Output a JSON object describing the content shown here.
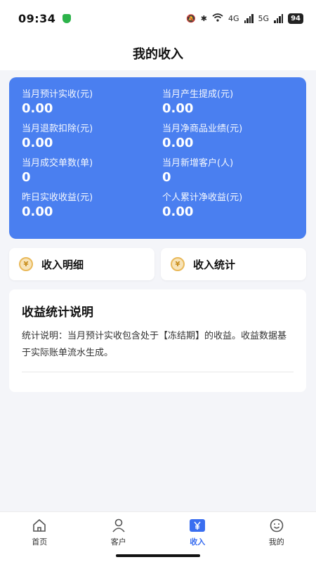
{
  "status_bar": {
    "time": "09:34",
    "network_4g": "4G",
    "network_5g": "5G",
    "battery": "94"
  },
  "header": {
    "title": "我的收入"
  },
  "stats": [
    {
      "label": "当月预计实收(元)",
      "value": "0.00"
    },
    {
      "label": "当月产生提成(元)",
      "value": "0.00"
    },
    {
      "label": "当月退款扣除(元)",
      "value": "0.00"
    },
    {
      "label": "当月净商品业绩(元)",
      "value": "0.00"
    },
    {
      "label": "当月成交单数(单)",
      "value": "0"
    },
    {
      "label": "当月新增客户(人)",
      "value": "0"
    },
    {
      "label": "昨日实收收益(元)",
      "value": "0.00"
    },
    {
      "label": "个人累计净收益(元)",
      "value": "0.00"
    }
  ],
  "actions": {
    "detail_label": "收入明细",
    "stats_label": "收入统计"
  },
  "info": {
    "title": "收益统计说明",
    "text": "统计说明：当月预计实收包含处于【冻结期】的收益。收益数据基于实际账单流水生成。"
  },
  "tabbar": {
    "items": [
      {
        "label": "首页",
        "icon": "home-icon"
      },
      {
        "label": "客户",
        "icon": "person-icon"
      },
      {
        "label": "收入",
        "icon": "yen-icon"
      },
      {
        "label": "我的",
        "icon": "smile-icon"
      }
    ],
    "active_color": "#3a6ef0"
  },
  "colors": {
    "card_blue": "#4a7ff0",
    "background": "#f4f5f9"
  }
}
